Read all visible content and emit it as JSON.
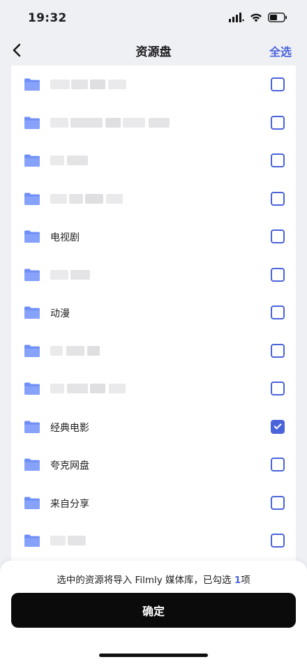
{
  "status": {
    "time": "19:32"
  },
  "nav": {
    "title": "资源盘",
    "select_all": "全选"
  },
  "list": [
    {
      "name": "",
      "blurred": true,
      "checked": false
    },
    {
      "name": "",
      "blurred": true,
      "checked": false
    },
    {
      "name": "",
      "blurred": true,
      "checked": false
    },
    {
      "name": "",
      "blurred": true,
      "checked": false
    },
    {
      "name": "电视剧",
      "blurred": false,
      "checked": false
    },
    {
      "name": "",
      "blurred": true,
      "checked": false
    },
    {
      "name": "动漫",
      "blurred": false,
      "checked": false
    },
    {
      "name": "",
      "blurred": true,
      "checked": false
    },
    {
      "name": "",
      "blurred": true,
      "checked": false
    },
    {
      "name": "经典电影",
      "blurred": false,
      "checked": true
    },
    {
      "name": "夸克网盘",
      "blurred": false,
      "checked": false
    },
    {
      "name": "来自分享",
      "blurred": false,
      "checked": false
    },
    {
      "name": "",
      "blurred": true,
      "checked": false
    }
  ],
  "bottom": {
    "hint_prefix": "选中的资源将导入 Filmly 媒体库，已勾选 ",
    "count": "1",
    "hint_suffix": "项",
    "confirm": "确定"
  },
  "colors": {
    "accent": "#4a63db",
    "folder": "#6f8ff6",
    "button": "#0b0b0c"
  },
  "icons": [
    "back-chevron-icon",
    "folder-icon",
    "checkbox-icon",
    "signal-icon",
    "wifi-icon",
    "battery-icon"
  ]
}
